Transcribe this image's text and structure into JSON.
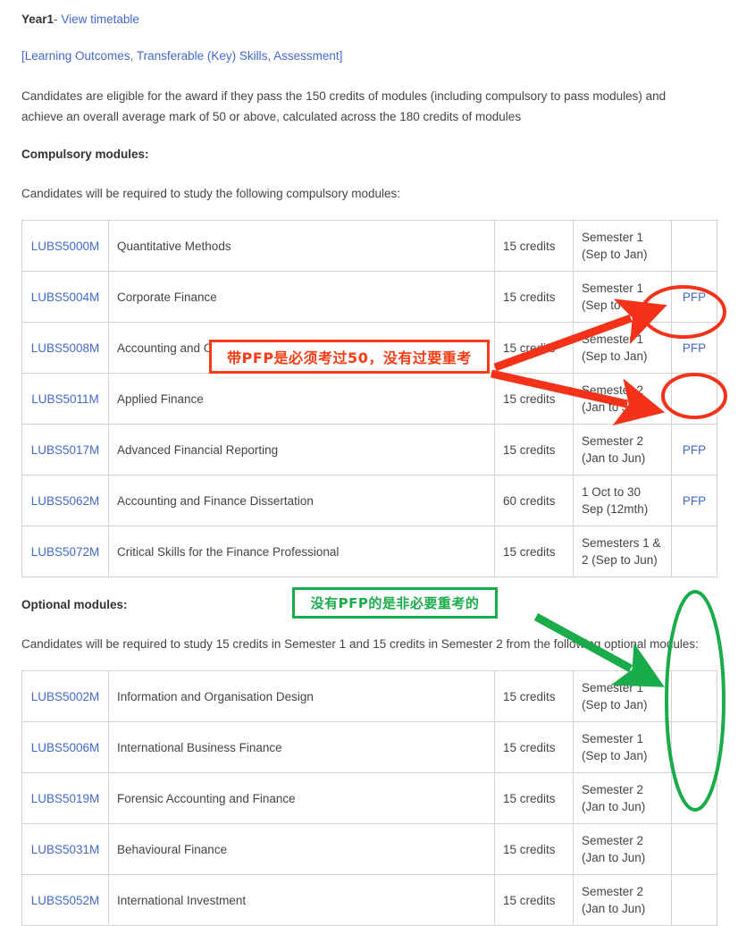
{
  "header": {
    "year_label": "Year1",
    "separator": "-",
    "timetable_link": "View timetable",
    "outcomes_link": "[Learning Outcomes, Transferable (Key) Skills, Assessment]"
  },
  "eligibility_paragraph": "Candidates are eligible for the award if they pass the 150 credits of modules (including compulsory to pass modules) and achieve an overall average mark of 50 or above, calculated across the 180 credits of modules",
  "compulsory": {
    "heading": "Compulsory modules:",
    "intro": "Candidates will be required to study the following compulsory modules:",
    "rows": [
      {
        "code": "LUBS5000M",
        "title": "Quantitative Methods",
        "credits": "15 credits",
        "semester": "Semester 1 (Sep to Jan)",
        "pfp": ""
      },
      {
        "code": "LUBS5004M",
        "title": "Corporate Finance",
        "credits": "15 credits",
        "semester": "Semester 1 (Sep to Jan)",
        "pfp": "PFP"
      },
      {
        "code": "LUBS5008M",
        "title": "Accounting and Organisational Performance",
        "credits": "15 credits",
        "semester": "Semester 1 (Sep to Jan)",
        "pfp": "PFP"
      },
      {
        "code": "LUBS5011M",
        "title": "Applied Finance",
        "credits": "15 credits",
        "semester": "Semester 2 (Jan to Jun)",
        "pfp": ""
      },
      {
        "code": "LUBS5017M",
        "title": "Advanced Financial Reporting",
        "credits": "15 credits",
        "semester": "Semester 2 (Jan to Jun)",
        "pfp": "PFP"
      },
      {
        "code": "LUBS5062M",
        "title": "Accounting and Finance Dissertation",
        "credits": "60 credits",
        "semester": "1 Oct to 30 Sep (12mth)",
        "pfp": "PFP"
      },
      {
        "code": "LUBS5072M",
        "title": "Critical Skills for the Finance Professional",
        "credits": "15 credits",
        "semester": "Semesters 1 & 2 (Sep to Jun)",
        "pfp": ""
      }
    ]
  },
  "optional": {
    "heading": "Optional modules:",
    "intro": "Candidates will be required to study 15 credits in Semester 1 and 15 credits in Semester 2 from the following optional modules:",
    "rows": [
      {
        "code": "LUBS5002M",
        "title": "Information and Organisation Design",
        "credits": "15 credits",
        "semester": "Semester 1 (Sep to Jan)",
        "pfp": ""
      },
      {
        "code": "LUBS5006M",
        "title": "International Business Finance",
        "credits": "15 credits",
        "semester": "Semester 1 (Sep to Jan)",
        "pfp": ""
      },
      {
        "code": "LUBS5019M",
        "title": "Forensic Accounting and Finance",
        "credits": "15 credits",
        "semester": "Semester 2 (Jan to Jun)",
        "pfp": ""
      },
      {
        "code": "LUBS5031M",
        "title": "Behavioural Finance",
        "credits": "15 credits",
        "semester": "Semester 2 (Jan to Jun)",
        "pfp": ""
      },
      {
        "code": "LUBS5052M",
        "title": "International Investment",
        "credits": "15 credits",
        "semester": "Semester 2 (Jan to Jun)",
        "pfp": ""
      }
    ]
  },
  "annotations": {
    "red_note": "带PFP是必须考过50，没有过要重考",
    "green_note": "没有PFP的是非必要重考的",
    "red_color": "#fa3c14",
    "green_color": "#1aab4b"
  }
}
